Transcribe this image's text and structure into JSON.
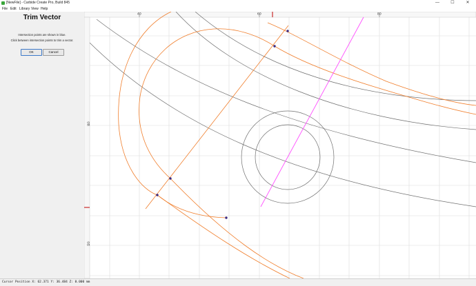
{
  "window": {
    "title": "[NewFile] - Carbide Create Pro, Build 845",
    "minimize": "—",
    "maximize": "☐",
    "close": "✕"
  },
  "menu": [
    "File",
    "Edit",
    "Library",
    "View",
    "Help"
  ],
  "panel": {
    "title": "Trim Vector",
    "message_line1": "Intersection points are shown in blue.",
    "message_line2": "Click between intersection points to trim a vector.",
    "ok_label": "OK",
    "cancel_label": "Cancel"
  },
  "rulers": {
    "top_ticks": [
      "40",
      "60",
      "80"
    ],
    "left_ticks": [
      "40",
      "20"
    ]
  },
  "status": {
    "cursor_position": "Cursor Position X: 62.371 Y: 36.484 Z: 0.000 mm"
  },
  "colors": {
    "orange": "#f07d2a",
    "gray": "#6e6e6e",
    "magenta": "#ff4dff",
    "intersection": "#3a2a80",
    "grid": "#dcdcdc",
    "ruler_marker": "#c00000"
  }
}
